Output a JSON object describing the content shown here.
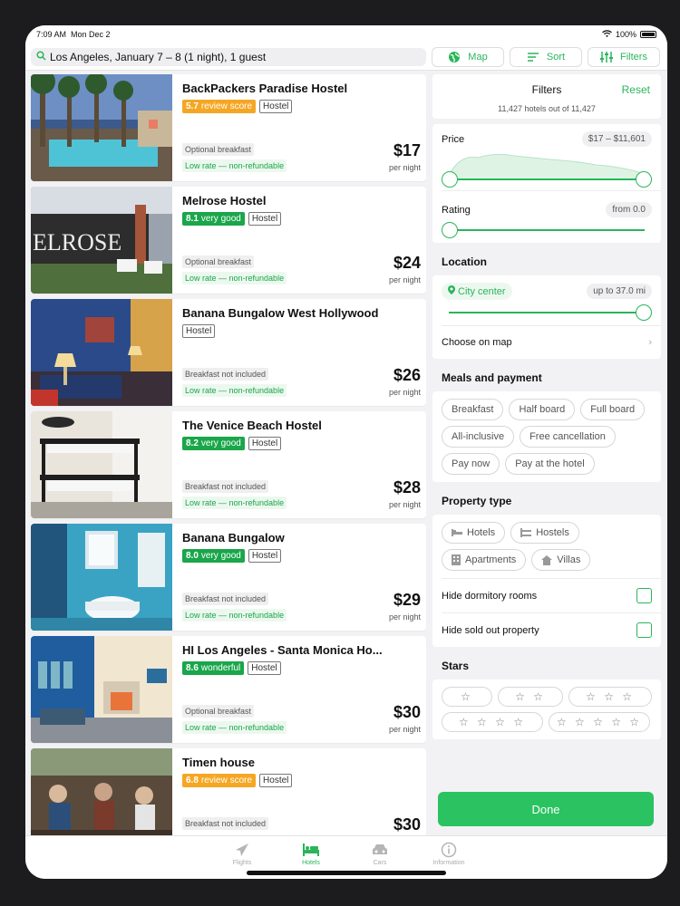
{
  "status": {
    "time": "7:09 AM",
    "date": "Mon Dec 2",
    "battery": "100%"
  },
  "search": {
    "query": "Los Angeles, January 7 – 8 (1 night), 1 guest"
  },
  "toolbar": {
    "map_label": "Map",
    "sort_label": "Sort",
    "filters_label": "Filters",
    "accent": "#2bb55b"
  },
  "hotels": [
    {
      "name": "BackPackers Paradise Hostel",
      "score": "5.7",
      "score_text": "review score",
      "score_level": "avg",
      "type": "Hostel",
      "meal": "Optional breakfast",
      "rate": "Low rate — non-refundable",
      "price": "$17",
      "per": "per night"
    },
    {
      "name": "Melrose Hostel",
      "score": "8.1",
      "score_text": "very good",
      "score_level": "good",
      "type": "Hostel",
      "meal": "Optional breakfast",
      "rate": "Low rate — non-refundable",
      "price": "$24",
      "per": "per night"
    },
    {
      "name": "Banana Bungalow West Hollywood",
      "score": "",
      "score_text": "",
      "score_level": "none",
      "type": "Hostel",
      "meal": "Breakfast not included",
      "rate": "Low rate — non-refundable",
      "price": "$26",
      "per": "per night"
    },
    {
      "name": "The Venice Beach Hostel",
      "score": "8.2",
      "score_text": "very good",
      "score_level": "good",
      "type": "Hostel",
      "meal": "Breakfast not included",
      "rate": "Low rate — non-refundable",
      "price": "$28",
      "per": "per night"
    },
    {
      "name": "Banana Bungalow",
      "score": "8.0",
      "score_text": "very good",
      "score_level": "good",
      "type": "Hostel",
      "meal": "Breakfast not included",
      "rate": "Low rate — non-refundable",
      "price": "$29",
      "per": "per night"
    },
    {
      "name": "HI Los Angeles - Santa Monica Ho...",
      "score": "8.6",
      "score_text": "wonderful",
      "score_level": "good",
      "type": "Hostel",
      "meal": "Optional breakfast",
      "rate": "Low rate — non-refundable",
      "price": "$30",
      "per": "per night"
    },
    {
      "name": "Timen house",
      "score": "6.8",
      "score_text": "review score",
      "score_level": "avg",
      "type": "Hostel",
      "meal": "Breakfast not included",
      "rate": "",
      "price": "$30",
      "per": ""
    }
  ],
  "filters": {
    "title": "Filters",
    "reset": "Reset",
    "count": "11,427 hotels out of 11,427",
    "price_label": "Price",
    "price_range": "$17 – $11,601",
    "rating_label": "Rating",
    "rating_value": "from 0.0",
    "location_title": "Location",
    "city_center": "City center",
    "distance": "up to 37.0 mi",
    "choose_map": "Choose on map",
    "meals_title": "Meals and payment",
    "meal_chips": [
      "Breakfast",
      "Half board",
      "Full board",
      "All-inclusive",
      "Free cancellation",
      "Pay now",
      "Pay at the hotel"
    ],
    "property_title": "Property type",
    "property_chips": [
      "Hotels",
      "Hostels",
      "Apartments",
      "Villas"
    ],
    "hide_dorm": "Hide dormitory rooms",
    "hide_sold": "Hide sold out property",
    "stars_title": "Stars",
    "star_chips": [
      "☆",
      "☆ ☆",
      "☆ ☆ ☆",
      "☆ ☆ ☆ ☆",
      "☆ ☆ ☆ ☆ ☆"
    ],
    "done": "Done"
  },
  "tabs": [
    {
      "label": "Flights",
      "icon": "plane-icon"
    },
    {
      "label": "Hotels",
      "icon": "bed-icon"
    },
    {
      "label": "Cars",
      "icon": "car-icon"
    },
    {
      "label": "Information",
      "icon": "info-icon"
    }
  ]
}
